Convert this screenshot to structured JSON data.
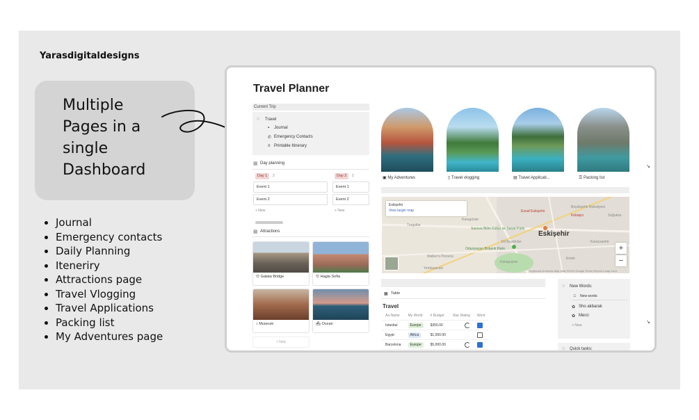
{
  "brand": "Yarasdigitaldesigns",
  "callout": [
    "Multiple",
    "Pages in a",
    "single",
    "Dashboard"
  ],
  "features": [
    "Journal",
    "Emergency contacts",
    "Daily Planning",
    "Iteneriry",
    "Attractions page",
    "Travel Vlogging",
    "Travel Applications",
    "Packing list",
    "My Adventures page"
  ],
  "planner": {
    "title": "Travel Planner",
    "current_trip": {
      "header": "Current Trip",
      "root": "Travel",
      "items": [
        "Journal",
        "Emergency Contacts",
        "Printable Itinerary"
      ]
    },
    "day_planning": {
      "header": "Day planning",
      "days": [
        {
          "tag": "Day 1",
          "count": "2",
          "events": [
            "Event 1",
            "Event 2"
          ]
        },
        {
          "tag": "Day 2",
          "count": "2",
          "events": [
            "Event 1",
            "Event 2"
          ]
        }
      ],
      "new": "+ New"
    },
    "attractions": {
      "header": "Attractions",
      "cards": [
        "Galata Bridge",
        "Hagia Sofia",
        "Museum",
        "Ocean"
      ],
      "new": "+ New"
    },
    "galleries": [
      "My Adventures",
      "Travel vlogging",
      "Travel Applicati...",
      "Packing list"
    ],
    "map": {
      "place": "Eskişehir",
      "link": "View larger map",
      "city": "Eskişehir",
      "labels": [
        "Turgutlar",
        "Karagözler",
        "Sazova Bilim Kültür ve Sanat Parkı",
        "Odunpazarı Botanik Parkı",
        "Esnaf Eskişehir",
        "Büyükşehir Belediyesi",
        "Kebapcı",
        "Karacasehir",
        "Yenikaracavi",
        "Walker's Pizzeria",
        "Soğuksu",
        "Eti Baydınlar",
        "Emek",
        "Karaçeşme"
      ],
      "attribution": "Keyboard shortcuts  Map data ©2024 Google  Terms  Report a map error",
      "zoom_in": "+",
      "zoom_out": "−"
    },
    "table": {
      "tab": "Table",
      "title": "Travel",
      "headers": [
        "Aa Name",
        "My World",
        "# Budget",
        "Star Rating",
        "Went"
      ],
      "rows": [
        {
          "name": "Istanbul",
          "world": "Europe",
          "world_color": "#dff0d8",
          "budget": "$350.00",
          "rating": true,
          "went": true
        },
        {
          "name": "Egypt",
          "world": "Africa",
          "world_color": "#dce8f7",
          "budget": "$1,000.00",
          "rating": false,
          "went": false
        },
        {
          "name": "Barcelona",
          "world": "Europe",
          "world_color": "#dff0d8",
          "budget": "$5,000.00",
          "rating": true,
          "went": true
        }
      ]
    },
    "new_words": {
      "header": "New Words:",
      "sub": "New words",
      "items": [
        "Sho akbarak",
        "Merci"
      ],
      "new": "+ New"
    },
    "quick_tasks": "Quick tasks:"
  }
}
